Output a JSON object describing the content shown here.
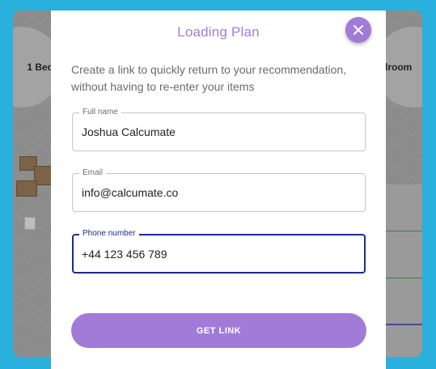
{
  "background": {
    "left_card_label": "1 Bed",
    "right_card_label": "droom"
  },
  "modal": {
    "title": "Loading Plan",
    "description": "Create a link to quickly return to your recommendation, without having to re-enter your items",
    "fields": {
      "full_name": {
        "label": "Full name",
        "value": "Joshua Calcumate"
      },
      "email": {
        "label": "Email",
        "value": "info@calcumate.co"
      },
      "phone": {
        "label": "Phone number",
        "value": "+44 123 456 789"
      }
    },
    "submit_label": "GET LINK"
  },
  "colors": {
    "outer_bg": "#29b0dd",
    "accent": "#a27bd8",
    "focus": "#1c2c8f"
  },
  "icons": {
    "close": "close-icon"
  }
}
